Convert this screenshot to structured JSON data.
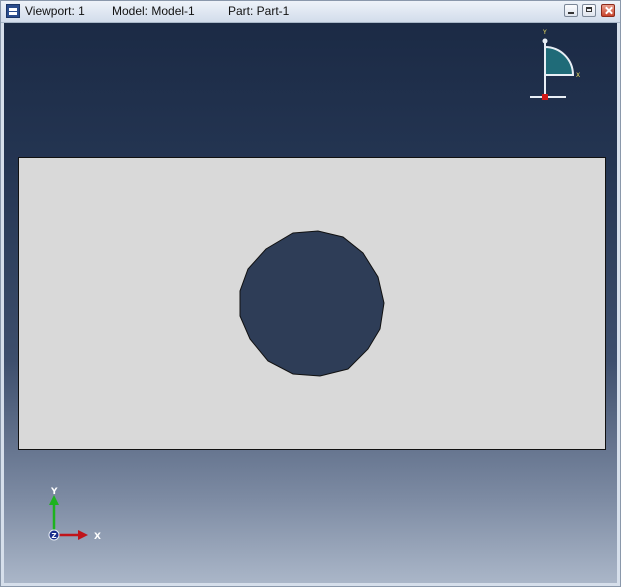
{
  "window": {
    "viewport_label": "Viewport: 1",
    "model_label": "Model: Model-1",
    "part_label": "Part: Part-1",
    "controls": [
      "minimize",
      "maximize",
      "close"
    ]
  },
  "icons": {
    "app": "viewport-window-icon",
    "minimize": "minimize-icon",
    "maximize": "maximize-icon",
    "close": "close-icon"
  },
  "viewcube": {
    "y_label": "Y",
    "x_label": "X",
    "color": "#1f6b78"
  },
  "triad": {
    "y_label": "Y",
    "x_label": "X",
    "z_label": "Z",
    "y_color": "#1db31d",
    "x_color": "#c0141a",
    "z_color": "#1a2d8c"
  },
  "model": {
    "plate_color": "#d9d9d9",
    "hole_color": "#2e3d57"
  }
}
